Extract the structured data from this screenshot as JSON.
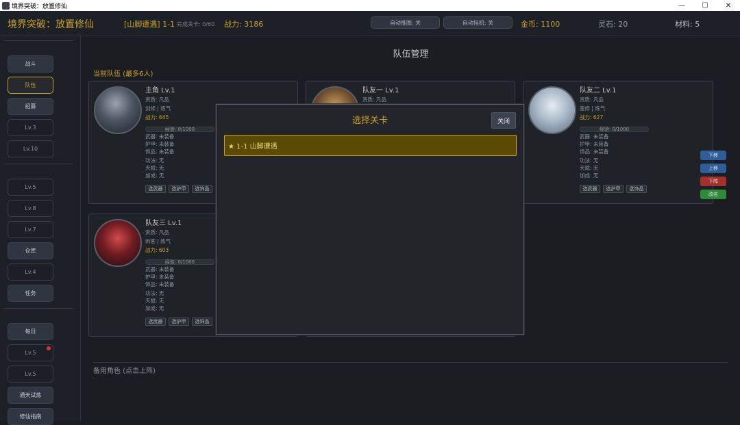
{
  "window": {
    "title": "境界突破：放置修仙",
    "controls": [
      "—",
      "☐",
      "✕"
    ]
  },
  "topbar": {
    "game_title": "境界突破：放置修仙",
    "stage": "[山脚遭遇] 1-1",
    "progress": "完成关卡: 0/60",
    "power": "战力: 3186",
    "auto_push": "自动推图: 关",
    "auto_idle": "自动挂机: 关",
    "gold": "金币: 1100",
    "lingshi": "灵石: 20",
    "material": "材料: 5"
  },
  "sidebar": {
    "items": [
      {
        "label": "战斗",
        "style": "a"
      },
      {
        "label": "队伍",
        "style": "active"
      },
      {
        "label": "招募",
        "style": "a"
      },
      {
        "label": "Lv.3",
        "style": "b"
      },
      {
        "label": "Lv.10",
        "style": "b"
      },
      {
        "label": "Lv.5",
        "style": "b"
      },
      {
        "label": "Lv.8",
        "style": "b"
      },
      {
        "label": "Lv.7",
        "style": "b"
      },
      {
        "label": "仓库",
        "style": "a"
      },
      {
        "label": "Lv.4",
        "style": "b"
      },
      {
        "label": "任务",
        "style": "a"
      },
      {
        "label": "每日",
        "style": "a"
      },
      {
        "label": "Lv.5",
        "style": "b"
      },
      {
        "label": "Lv.5",
        "style": "b"
      },
      {
        "label": "通天试炼",
        "style": "a"
      },
      {
        "label": "修仙指南",
        "style": "a"
      }
    ]
  },
  "main": {
    "title": "队伍管理",
    "team_label": "当前队伍 (最多6人)",
    "bench_label": "备用角色 (点击上阵)",
    "cards": [
      {
        "name": "主角 Lv.1",
        "aptitude": "资质: 凡品",
        "role": "剑修 | 炼气",
        "power": "战力: 645",
        "exp": "经验: 0/1000",
        "weapon": "武器: 未装备",
        "armor": "护甲: 未装备",
        "accessory": "饰品: 未装备",
        "skill": "功法: 无",
        "talent": "天赋: 无",
        "bonus": "加成: 无"
      },
      {
        "name": "队友一 Lv.1",
        "aptitude": "资质: 凡品",
        "role": "",
        "power": "",
        "exp": "",
        "weapon": "",
        "armor": "",
        "accessory": "",
        "skill": "",
        "talent": "",
        "bonus": ""
      },
      {
        "name": "队友二 Lv.1",
        "aptitude": "资质: 凡品",
        "role": "医修 | 炼气",
        "power": "战力: 627",
        "exp": "经验: 0/1000",
        "weapon": "武器: 未装备",
        "armor": "护甲: 未装备",
        "accessory": "饰品: 未装备",
        "skill": "功法: 无",
        "talent": "天赋: 无",
        "bonus": "加成: 无"
      },
      {
        "name": "队友三 Lv.1",
        "aptitude": "资质: 凡品",
        "role": "刺客 | 炼气",
        "power": "战力: 603",
        "exp": "经验: 0/1000",
        "weapon": "武器: 未装备",
        "armor": "护甲: 未装备",
        "accessory": "饰品: 未装备",
        "skill": "功法: 无",
        "talent": "天赋: 无",
        "bonus": "加成: 无"
      }
    ],
    "slot_buttons": {
      "weapon": "选武器",
      "armor": "选护甲",
      "accessory": "选饰品"
    },
    "side_buttons": {
      "down": "下移",
      "up": "上移",
      "unequip": "下阵",
      "change": "改名"
    }
  },
  "modal": {
    "title": "选择关卡",
    "close": "关闭",
    "items": [
      "★ 1-1 山脚遭遇"
    ]
  },
  "colors": {
    "gold": "#c9a227",
    "bg": "#1b1d22",
    "modal_bg": "#23252b",
    "selected": "#5b4a04"
  }
}
